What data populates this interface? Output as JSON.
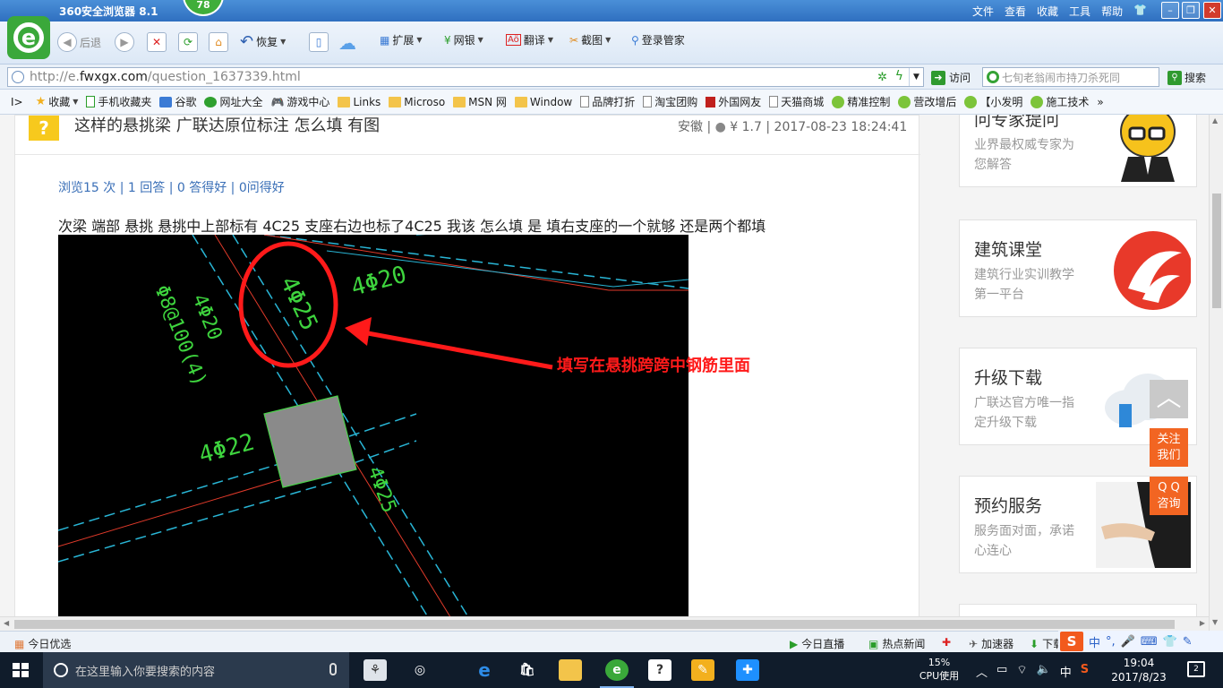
{
  "browser": {
    "title": "360安全浏览器 8.1",
    "badge": "78",
    "menus": [
      "文件",
      "查看",
      "收藏",
      "工具",
      "帮助"
    ],
    "window_controls": [
      "minimize",
      "restore",
      "close"
    ]
  },
  "toolbar": {
    "back_label": "后退",
    "restore_label": "恢复",
    "extend_label": "扩展",
    "bank_label": "网银",
    "translate_label": "翻译",
    "screenshot_label": "截图",
    "login_manager_label": "登录管家"
  },
  "address": {
    "url_prefix": "http://e.",
    "url_domain": "fwxgx.com",
    "url_path": "/question_1637339.html",
    "visit_label": "访问",
    "search_placeholder": "七旬老翁闹市持刀杀死同",
    "search_label": "搜索"
  },
  "bookmarks": {
    "items": [
      {
        "label": "收藏",
        "icon": "star-icon"
      },
      {
        "label": "手机收藏夹",
        "icon": "phone-icon"
      },
      {
        "label": "谷歌",
        "icon": "google-icon"
      },
      {
        "label": "网址大全",
        "icon": "green-circle-icon"
      },
      {
        "label": "游戏中心",
        "icon": "gamepad-icon"
      },
      {
        "label": "Links",
        "icon": "folder-icon"
      },
      {
        "label": "Microso",
        "icon": "folder-icon"
      },
      {
        "label": "MSN 网",
        "icon": "folder-icon"
      },
      {
        "label": "Window",
        "icon": "folder-icon"
      },
      {
        "label": "品牌打折",
        "icon": "page-icon"
      },
      {
        "label": "淘宝团购",
        "icon": "page-icon"
      },
      {
        "label": "外国网友",
        "icon": "red-page-icon"
      },
      {
        "label": "天猫商城",
        "icon": "page-icon"
      },
      {
        "label": "精准控制",
        "icon": "chat-icon"
      },
      {
        "label": "营改增后",
        "icon": "chat-icon"
      },
      {
        "label": "【小发明",
        "icon": "chat-icon"
      },
      {
        "label": "施工技术",
        "icon": "chat-icon"
      }
    ]
  },
  "question": {
    "icon_char": "?",
    "title": "这样的悬挑梁 广联达原位标注 怎么填 有图",
    "region": "安徽",
    "reward": "¥ 1.7",
    "date": "2017-08-23 18:24:41",
    "stats": "浏览15 次 | 1 回答 | 0 答得好 | 0问得好",
    "body": "次梁 端部 悬挑  悬挑中上部标有 4C25 支座右边也标了4C25 我该 怎么填 是 填右支座的一个就够 还是两个都填"
  },
  "cad": {
    "labels": [
      "4Φ25",
      "4Φ20",
      "Φ8@100(4)",
      "4Φ20",
      "4Φ22",
      "4Φ25"
    ],
    "annotation": "填写在悬挑跨跨中钢筋里面"
  },
  "sidebar": {
    "cards": [
      {
        "title": "问专家提问",
        "desc": "业界最权威专家为您解答"
      },
      {
        "title": "建筑课堂",
        "desc": "建筑行业实训教学第一平台"
      },
      {
        "title": "升级下载",
        "desc": "广联达官方唯一指定升级下载"
      },
      {
        "title": "预约服务",
        "desc": "服务面对面，承诺心连心"
      }
    ],
    "follow_label_1": "关注",
    "follow_label_2": "我们",
    "qq_label_1": "Q Q",
    "qq_label_2": "咨询",
    "top_arrow": "︿"
  },
  "status": {
    "today_pick": "今日优选",
    "live": "今日直播",
    "hot_news": "热点新闻",
    "accelerator": "加速器",
    "download": "下载"
  },
  "ime": {
    "logo": "S",
    "mode": "中"
  },
  "taskbar": {
    "search_placeholder": "在这里输入你要搜索的内容",
    "cpu_percent": "15%",
    "cpu_label": "CPU使用",
    "input_lang": "中",
    "time": "19:04",
    "date": "2017/8/23",
    "notifications": "2"
  }
}
